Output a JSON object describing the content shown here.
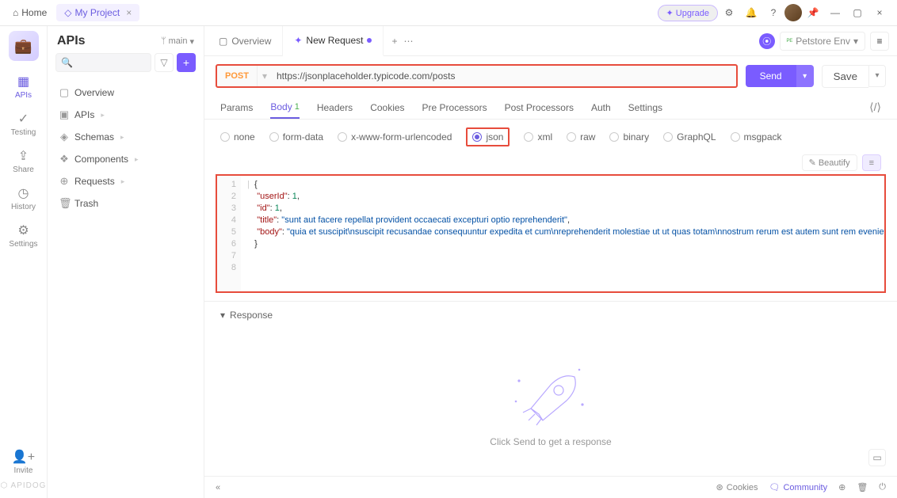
{
  "topbar": {
    "home": "Home",
    "project_tab": "My Project",
    "upgrade": "Upgrade"
  },
  "rail": {
    "items": [
      {
        "icon": "▦",
        "label": "APIs"
      },
      {
        "icon": "✓",
        "label": "Testing"
      },
      {
        "icon": "⇪",
        "label": "Share"
      },
      {
        "icon": "◷",
        "label": "History"
      },
      {
        "icon": "⚙",
        "label": "Settings"
      }
    ],
    "invite": {
      "icon": "+",
      "label": "Invite"
    },
    "brand": "⬡ APIDOG"
  },
  "sidebar": {
    "title": "APIs",
    "branch_icon": "ᛘ",
    "branch": "main",
    "search_placeholder": "",
    "tree": [
      {
        "icon": "▢",
        "label": "Overview"
      },
      {
        "icon": "▣",
        "label": "APIs",
        "caret": "▸"
      },
      {
        "icon": "◈",
        "label": "Schemas",
        "caret": "▸"
      },
      {
        "icon": "❖",
        "label": "Components",
        "caret": "▸"
      },
      {
        "icon": "⊕",
        "label": "Requests",
        "caret": "▸"
      },
      {
        "icon": "🗑",
        "label": "Trash"
      }
    ]
  },
  "tabs": {
    "overview": "Overview",
    "newreq": "New Request",
    "env_icon": "⦿",
    "env_prefix": "ᴾᴱ",
    "env": "Petstore Env"
  },
  "request": {
    "method": "POST",
    "url": "https://jsonplaceholder.typicode.com/posts",
    "send": "Send",
    "save": "Save"
  },
  "reqtabs": {
    "params": "Params",
    "body": "Body",
    "body_count": "1",
    "headers": "Headers",
    "cookies": "Cookies",
    "pre": "Pre Processors",
    "post": "Post Processors",
    "auth": "Auth",
    "settings": "Settings"
  },
  "bodytypes": {
    "none": "none",
    "form": "form-data",
    "urlenc": "x-www-form-urlencoded",
    "json": "json",
    "xml": "xml",
    "raw": "raw",
    "binary": "binary",
    "graphql": "GraphQL",
    "msgpack": "msgpack"
  },
  "beautify": "Beautify",
  "editor": {
    "lines": [
      "1",
      "2",
      "3",
      "4",
      "5",
      "6",
      "7",
      "8"
    ]
  },
  "json_body": {
    "userId_key": "\"userId\"",
    "userId_val": "1",
    "id_key": "\"id\"",
    "id_val": "1",
    "title_key": "\"title\"",
    "title_val": "\"sunt aut facere repellat provident occaecati excepturi optio reprehenderit\"",
    "body_key": "\"body\"",
    "body_val": "\"quia et suscipit\\nsuscipit recusandae consequuntur expedita et cum\\nreprehenderit molestiae ut ut quas totam\\nnostrum rerum est autem sunt rem eveniet architecto\""
  },
  "response": {
    "header": "Response",
    "empty": "Click Send to get a response"
  },
  "footer": {
    "cookies": "Cookies",
    "community": "Community"
  }
}
